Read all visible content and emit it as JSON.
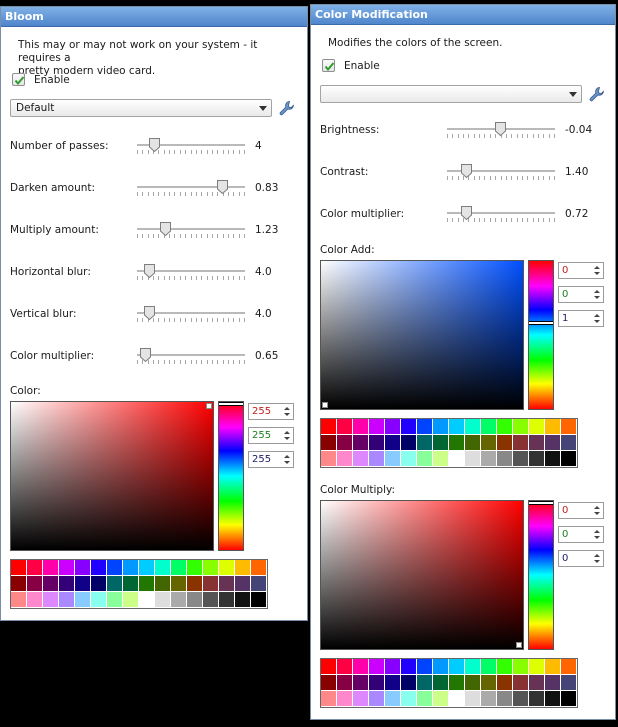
{
  "bloom": {
    "title": "Bloom",
    "description_line1": "This may or may not work on your system - it requires a",
    "description_line2": "pretty modern video card.",
    "enable_label": "Enable",
    "enabled": true,
    "preset_value": "Default",
    "sliders": [
      {
        "label": "Number of passes:",
        "value": "4",
        "level": 0.12
      },
      {
        "label": "Darken amount:",
        "value": "0.83",
        "level": 0.82
      },
      {
        "label": "Multiply amount:",
        "value": "1.23",
        "level": 0.24
      },
      {
        "label": "Horizontal blur:",
        "value": "4.0",
        "level": 0.07
      },
      {
        "label": "Vertical blur:",
        "value": "4.0",
        "level": 0.07
      },
      {
        "label": "Color multiplier:",
        "value": "0.65",
        "level": 0.03
      }
    ],
    "color_label": "Color:",
    "rgb": {
      "r": "255",
      "g": "255",
      "b": "255"
    },
    "colors": {
      "hue": "#ff0000"
    }
  },
  "color_mod": {
    "title": "Color Modification",
    "description": "Modifies the colors of the screen.",
    "enable_label": "Enable",
    "enabled": true,
    "preset_value": "",
    "sliders": [
      {
        "label": "Brightness:",
        "value": "-0.04",
        "level": 0.49
      },
      {
        "label": "Contrast:",
        "value": "1.40",
        "level": 0.14
      },
      {
        "label": "Color multiplier:",
        "value": "0.72",
        "level": 0.14
      }
    ],
    "color_add_label": "Color Add:",
    "color_add_rgb": {
      "r": "0",
      "g": "0",
      "b": "1"
    },
    "color_add_hue": "#0050ff",
    "color_multiply_label": "Color Multiply:",
    "color_multiply_rgb": {
      "r": "0",
      "g": "0",
      "b": "0"
    },
    "color_multiply_hue": "#ff0000"
  },
  "palette": [
    [
      "#ff0000",
      "#ff0044",
      "#ff00aa",
      "#cc00ff",
      "#8800ff",
      "#2200ff",
      "#0044ff",
      "#0099ff",
      "#00ccff",
      "#00ffcc",
      "#00ff66",
      "#33ff00",
      "#88ff00",
      "#ddff00",
      "#ffbb00",
      "#ff6600"
    ],
    [
      "#880000",
      "#880044",
      "#660066",
      "#330077",
      "#110088",
      "#000066",
      "#006666",
      "#006633",
      "#227700",
      "#446600",
      "#666600",
      "#883300",
      "#883333",
      "#663355",
      "#553366",
      "#444477"
    ],
    [
      "#ff8888",
      "#ff88cc",
      "#dd88ff",
      "#aa88ff",
      "#88ccff",
      "#88ffee",
      "#88ff99",
      "#ccff88",
      "#ffffff",
      "#dddddd",
      "#aaaaaa",
      "#888888",
      "#555555",
      "#333333",
      "#111111",
      "#000000"
    ]
  ]
}
